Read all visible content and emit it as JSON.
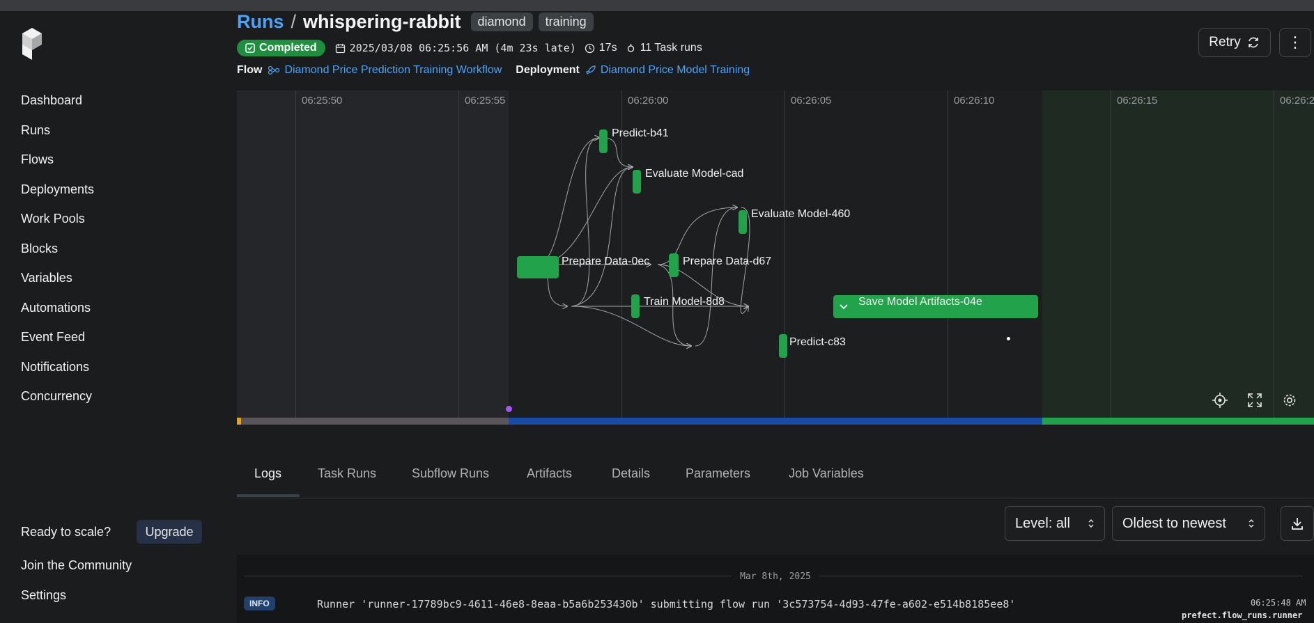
{
  "sidebar": {
    "nav": [
      "Dashboard",
      "Runs",
      "Flows",
      "Deployments",
      "Work Pools",
      "Blocks",
      "Variables",
      "Automations",
      "Event Feed",
      "Notifications",
      "Concurrency"
    ],
    "ready_text": "Ready to scale?",
    "upgrade_label": "Upgrade",
    "community_label": "Join the Community",
    "settings_label": "Settings"
  },
  "header": {
    "breadcrumb_root": "Runs",
    "separator": "/",
    "run_name": "whispering-rabbit",
    "tags": [
      "diamond",
      "training"
    ],
    "status": "Completed",
    "start_time": "2025/03/08 06:25:56 AM (4m 23s late)",
    "duration": "17s",
    "task_runs": "11 Task runs",
    "flow_label": "Flow",
    "flow_name": "Diamond Price Prediction Training Workflow",
    "deployment_label": "Deployment",
    "deployment_name": "Diamond Price Model Training",
    "retry_label": "Retry",
    "more_label": "⋮"
  },
  "graph": {
    "ticks": [
      "06:25:50",
      "06:25:55",
      "06:26:00",
      "06:26:05",
      "06:26:10",
      "06:26:15",
      "06:26:2"
    ],
    "nodes": {
      "predict_b41": "Predict-b41",
      "evaluate_cad": "Evaluate Model-cad",
      "evaluate_460": "Evaluate Model-460",
      "prepare_0ec": "Prepare Data-0ec",
      "prepare_d67": "Prepare Data-d67",
      "train_8d8": "Train Model-8d8",
      "save_04e": "Save Model Artifacts-04e",
      "predict_c83": "Predict-c83"
    },
    "colors": {
      "completed": "#22a24a",
      "pending": "#5a545b",
      "running": "#1a4aa8",
      "late": "#e0a020"
    }
  },
  "tabs": [
    "Logs",
    "Task Runs",
    "Subflow Runs",
    "Artifacts",
    "Details",
    "Parameters",
    "Job Variables"
  ],
  "log_controls": {
    "level": "Level: all",
    "order": "Oldest to newest"
  },
  "logs": {
    "date": "Mar 8th, 2025",
    "entries": [
      {
        "level": "INFO",
        "message": "Runner 'runner-17789bc9-4611-46e8-8eaa-b5a6b253430b' submitting flow run '3c573754-4d93-47fe-a602-e514b8185ee8'",
        "time": "06:25:48 AM",
        "logger": "prefect.flow_runs.runner"
      }
    ]
  }
}
